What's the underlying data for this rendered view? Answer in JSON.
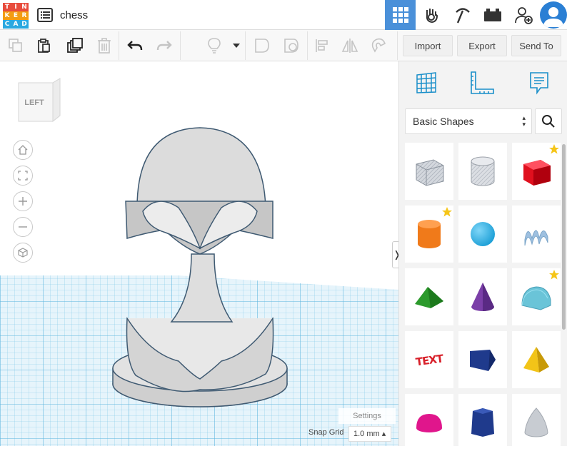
{
  "app": {
    "logo_letters": [
      "T",
      "I",
      "N",
      "K",
      "E",
      "R",
      "C",
      "A",
      "D"
    ],
    "logo_colors": [
      "#e84c3d",
      "#e84c3d",
      "#e84c3d",
      "#f39c12",
      "#f39c12",
      "#f39c12",
      "#2aa8e0",
      "#2aa8e0",
      "#2aa8e0"
    ],
    "design_title": "chess"
  },
  "topbar": {
    "icons": [
      "3d-design-icon",
      "circuits-hand-icon",
      "pickaxe-icon",
      "bricks-icon",
      "add-user-icon",
      "avatar"
    ]
  },
  "toolbar": {
    "import_label": "Import",
    "export_label": "Export",
    "sendto_label": "Send To"
  },
  "workplane": {
    "viewcube_face": "LEFT",
    "settings_label": "Settings",
    "snap_label": "Snap Grid",
    "snap_value": "1.0 mm ▴",
    "grid_color": "#7ec8e8",
    "piece_color": "#d9d9d9"
  },
  "panel": {
    "category": "Basic Shapes",
    "shapes": [
      {
        "name": "box-striped",
        "color": "#b8bec8",
        "favorite": false
      },
      {
        "name": "cylinder-striped",
        "color": "#c8ccd2",
        "favorite": false
      },
      {
        "name": "box",
        "color": "#e0101e",
        "favorite": true
      },
      {
        "name": "cylinder",
        "color": "#f07a1a",
        "favorite": true
      },
      {
        "name": "sphere",
        "color": "#1c9fd6",
        "favorite": false
      },
      {
        "name": "scribble",
        "color": "#9ec0e0",
        "favorite": false
      },
      {
        "name": "roof",
        "color": "#2c9a2c",
        "favorite": false
      },
      {
        "name": "cone",
        "color": "#7b3fa8",
        "favorite": false
      },
      {
        "name": "round-roof",
        "color": "#6ac4d8",
        "favorite": true
      },
      {
        "name": "text",
        "color": "#d8202a",
        "favorite": false
      },
      {
        "name": "wedge",
        "color": "#1f3a8c",
        "favorite": false
      },
      {
        "name": "pyramid",
        "color": "#f2c418",
        "favorite": false
      },
      {
        "name": "half-sphere",
        "color": "#e0168c",
        "favorite": false
      },
      {
        "name": "polygon",
        "color": "#1f3a8c",
        "favorite": false
      },
      {
        "name": "paraboloid",
        "color": "#c8ccd2",
        "favorite": false
      }
    ]
  }
}
